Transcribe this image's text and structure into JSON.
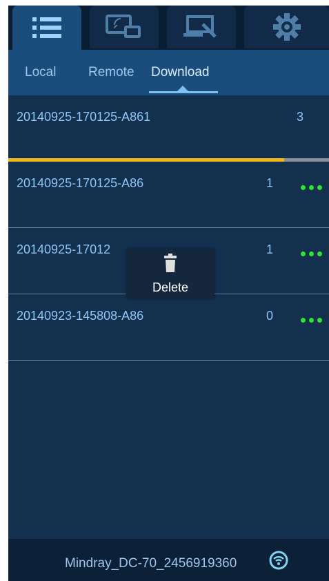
{
  "top_tabs": [
    {
      "icon": "list-icon",
      "active": true
    },
    {
      "icon": "remote-screen-icon",
      "active": false
    },
    {
      "icon": "laptop-icon",
      "active": false
    },
    {
      "icon": "gear-icon",
      "active": false
    }
  ],
  "sub_tabs": {
    "local": "Local",
    "remote": "Remote",
    "download": "Download",
    "active": "download"
  },
  "downloads": [
    {
      "name": "20140925-170125-A861",
      "count": "3",
      "progress": 0.86,
      "menu": false
    },
    {
      "name": "20140925-170125-A86",
      "count": "1",
      "menu": true
    },
    {
      "name": "20140925-17012",
      "count": "1",
      "menu": true
    },
    {
      "name": "20140923-145808-A86",
      "count": "0",
      "menu": true
    }
  ],
  "context_menu": {
    "icon": "trash-icon",
    "label": "Delete"
  },
  "status_bar": {
    "device_name": "Mindray_DC-70_2456919360",
    "icon": "wifi-icon"
  },
  "colors": {
    "background": "#13304f",
    "accent": "#1a4d7c",
    "text": "#8ec6f4",
    "progress": "#f5b417",
    "dots": "#2fe62f"
  }
}
